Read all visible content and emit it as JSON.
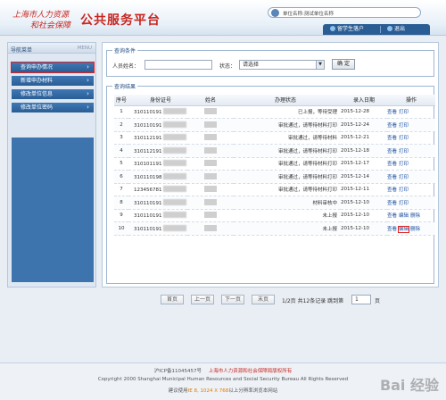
{
  "header": {
    "logo_line1": "上海市人力资源",
    "logo_line2": "和社会保障",
    "system_title": "公共服务平台",
    "user_text": "单位名称:测试单位名称",
    "btn_student": "留学生落户",
    "btn_logout": "退出"
  },
  "sidebar": {
    "title": "导航菜单",
    "menu_label": "MENU",
    "items": [
      {
        "label": "查询申办情况",
        "active": true
      },
      {
        "label": "新增申办材料"
      },
      {
        "label": "修改单位信息"
      },
      {
        "label": "修改单位密码"
      }
    ]
  },
  "query": {
    "legend": "查询条件",
    "name_label": "人员姓名：",
    "name_value": "",
    "status_label": "状态：",
    "status_value": "请选择",
    "confirm_label": "确 定"
  },
  "results": {
    "legend": "查询结果",
    "columns": [
      "序号",
      "身份证号",
      "姓名",
      "办理状态",
      "录入日期",
      "操作"
    ],
    "rows": [
      {
        "no": "1",
        "id": "310110191",
        "status": "已上报，等待受理",
        "date": "2015-12-28",
        "ops": [
          "查看",
          "打印"
        ]
      },
      {
        "no": "2",
        "id": "310110191",
        "status": "审批通过，请等待材料打印",
        "date": "2015-12-24",
        "ops": [
          "查看",
          "打印"
        ]
      },
      {
        "no": "3",
        "id": "310112191",
        "status": "审批通过，请等待材料",
        "date": "2015-12-21",
        "ops": [
          "查看",
          "打印"
        ]
      },
      {
        "no": "4",
        "id": "310112191",
        "status": "审批通过，请等待材料打印",
        "date": "2015-12-18",
        "ops": [
          "查看",
          "打印"
        ]
      },
      {
        "no": "5",
        "id": "310101191",
        "status": "审批通过，请等待材料打印",
        "date": "2015-12-17",
        "ops": [
          "查看",
          "打印"
        ]
      },
      {
        "no": "6",
        "id": "310110198",
        "status": "审批通过，请等待材料打印",
        "date": "2015-12-14",
        "ops": [
          "查看",
          "打印"
        ]
      },
      {
        "no": "7",
        "id": "123456781",
        "status": "审批通过，请等待材料打印",
        "date": "2015-12-11",
        "ops": [
          "查看",
          "打印"
        ]
      },
      {
        "no": "8",
        "id": "310110191",
        "status": "材料审核中",
        "date": "2015-12-10",
        "ops": [
          "查看",
          "打印"
        ]
      },
      {
        "no": "9",
        "id": "310110191",
        "status": "未上报",
        "date": "2015-12-10",
        "ops": [
          "查看",
          "编辑",
          "删除"
        ]
      },
      {
        "no": "10",
        "id": "310110191",
        "status": "未上报",
        "date": "2015-12-10",
        "ops": [
          "查看",
          "编辑",
          "删除"
        ]
      }
    ]
  },
  "pager": {
    "first": "首页",
    "prev": "上一页",
    "next": "下一页",
    "last": "末页",
    "info": "1/2页 共12条记录 跳到第",
    "page_value": "1",
    "page_suffix": "页"
  },
  "footer": {
    "icp": "沪ICP备11045457号",
    "owner": "上海市人力资源和社会保障局版权所有",
    "copyright": "Copyright 2000 Shanghai Municipal Human Resources and Social Security Bureau All Rights Reserved",
    "tip_prefix": "建议使用",
    "tip_browser": "IE 8, 1024 X 768",
    "tip_suffix": "以上分辨率浏览本网站",
    "watermark": "Bai 经验"
  },
  "colors": {
    "brand_red": "#c8261f",
    "nav_blue": "#2a5d94",
    "highlight": "#e02020"
  }
}
